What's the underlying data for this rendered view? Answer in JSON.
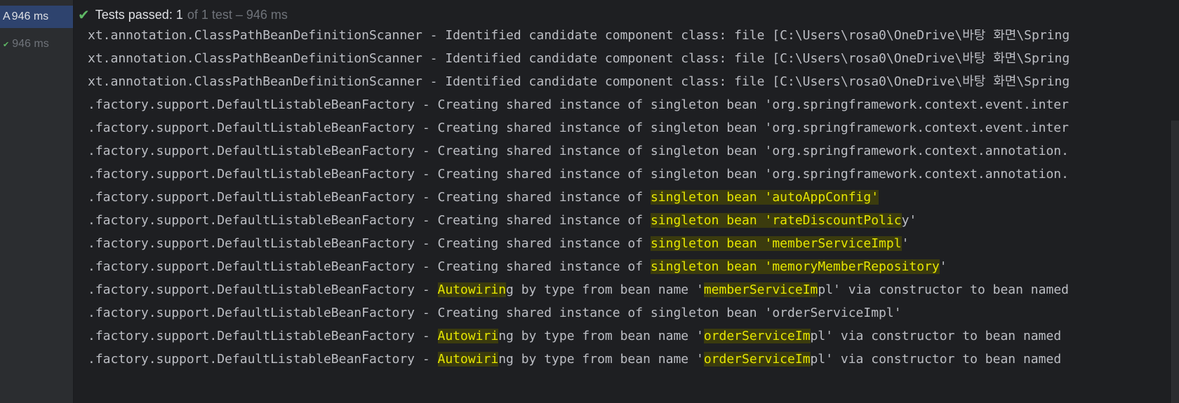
{
  "tree": {
    "root_prefix": "A",
    "root_time": "946 ms",
    "child_time": "946 ms"
  },
  "status": {
    "label": "Tests passed: 1",
    "detail": "of 1 test – 946 ms"
  },
  "colors": {
    "background": "#1e1f22",
    "sidebar": "#2b2d30",
    "selected": "#2e436e",
    "pass_green": "#5fb865",
    "highlight_yellow": "#e6e600"
  },
  "icons": {
    "status": "check-icon",
    "child_status": "check-icon"
  },
  "log_lines": [
    [
      {
        "t": "xt.annotation.ClassPathBeanDefinitionScanner - Identified candidate component class: file [C:\\Users\\rosa0\\OneDrive\\바탕 화면\\Spring"
      }
    ],
    [
      {
        "t": "xt.annotation.ClassPathBeanDefinitionScanner - Identified candidate component class: file [C:\\Users\\rosa0\\OneDrive\\바탕 화면\\Spring"
      }
    ],
    [
      {
        "t": "xt.annotation.ClassPathBeanDefinitionScanner - Identified candidate component class: file [C:\\Users\\rosa0\\OneDrive\\바탕 화면\\Spring"
      }
    ],
    [
      {
        "t": ".factory.support.DefaultListableBeanFactory - Creating shared instance of singleton bean 'org.springframework.context.event.inter"
      }
    ],
    [
      {
        "t": ".factory.support.DefaultListableBeanFactory - Creating shared instance of singleton bean 'org.springframework.context.event.inter"
      }
    ],
    [
      {
        "t": ".factory.support.DefaultListableBeanFactory - Creating shared instance of singleton bean 'org.springframework.context.annotation."
      }
    ],
    [
      {
        "t": ".factory.support.DefaultListableBeanFactory - Creating shared instance of singleton bean 'org.springframework.context.annotation."
      }
    ],
    [
      {
        "t": ".factory.support.DefaultListableBeanFactory - Creating shared instance of "
      },
      {
        "t": "singleton bean 'autoAppConfig'",
        "h": true
      }
    ],
    [
      {
        "t": ".factory.support.DefaultListableBeanFactory - Creating shared instance of "
      },
      {
        "t": "singleton bean 'rateDiscountPolic",
        "h": true
      },
      {
        "t": "y'"
      }
    ],
    [
      {
        "t": ".factory.support.DefaultListableBeanFactory - Creating shared instance of "
      },
      {
        "t": "singleton bean 'memberServiceImpl",
        "h": true
      },
      {
        "t": "'"
      }
    ],
    [
      {
        "t": ".factory.support.DefaultListableBeanFactory - Creating shared instance of "
      },
      {
        "t": "singleton bean 'memoryMemberRepository",
        "h": true
      },
      {
        "t": "'"
      }
    ],
    [
      {
        "t": ".factory.support.DefaultListableBeanFactory - "
      },
      {
        "t": "Autowirin",
        "h": true
      },
      {
        "t": "g by type from bean name '"
      },
      {
        "t": "memberServiceIm",
        "h": true
      },
      {
        "t": "pl' via constructor to bean named"
      }
    ],
    [
      {
        "t": ".factory.support.DefaultListableBeanFactory - Creating shared instance of singleton bean 'orderServiceImpl'"
      }
    ],
    [
      {
        "t": ".factory.support.DefaultListableBeanFactory - "
      },
      {
        "t": "Autowiri",
        "h": true
      },
      {
        "t": "ng by type from bean name '"
      },
      {
        "t": "orderServiceIm",
        "h": true
      },
      {
        "t": "pl' via constructor to bean named"
      }
    ],
    [
      {
        "t": ".factory.support.DefaultListableBeanFactory - "
      },
      {
        "t": "Autowiri",
        "h": true
      },
      {
        "t": "ng by type from bean name '"
      },
      {
        "t": "orderServiceIm",
        "h": true
      },
      {
        "t": "pl' via constructor to bean named"
      }
    ]
  ]
}
